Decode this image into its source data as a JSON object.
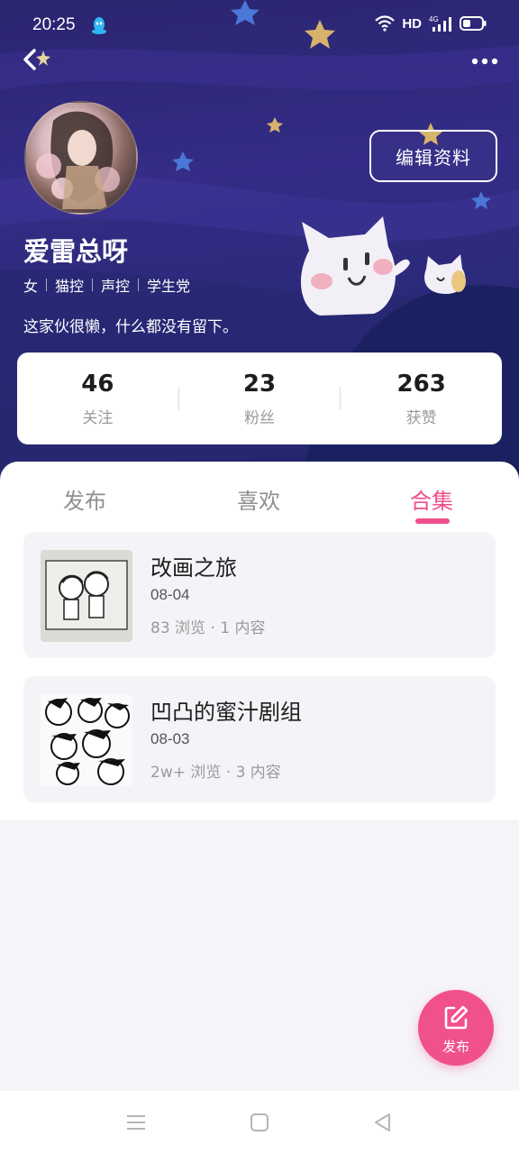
{
  "status_bar": {
    "time": "20:25",
    "network": "HD",
    "signal": "4G"
  },
  "profile": {
    "username": "爱雷总呀",
    "tags": [
      "女",
      "猫控",
      "声控",
      "学生党"
    ],
    "bio": "这家伙很懒，什么都没有留下。",
    "edit_label": "编辑资料"
  },
  "stats": [
    {
      "value": "46",
      "label": "关注"
    },
    {
      "value": "23",
      "label": "粉丝"
    },
    {
      "value": "263",
      "label": "获赞"
    }
  ],
  "tabs": [
    {
      "label": "发布"
    },
    {
      "label": "喜欢"
    },
    {
      "label": "合集"
    }
  ],
  "active_tab": "合集",
  "collections": [
    {
      "title": "改画之旅",
      "date": "08-04",
      "meta": "83 浏览 · 1 内容"
    },
    {
      "title": "凹凸的蜜汁剧组",
      "date": "08-03",
      "meta": "2w+ 浏览 · 3 内容"
    }
  ],
  "fab": {
    "label": "发布"
  },
  "colors": {
    "accent": "#ee4f8b",
    "hero_bg": "#2a2570",
    "fab": "#f0508b"
  }
}
